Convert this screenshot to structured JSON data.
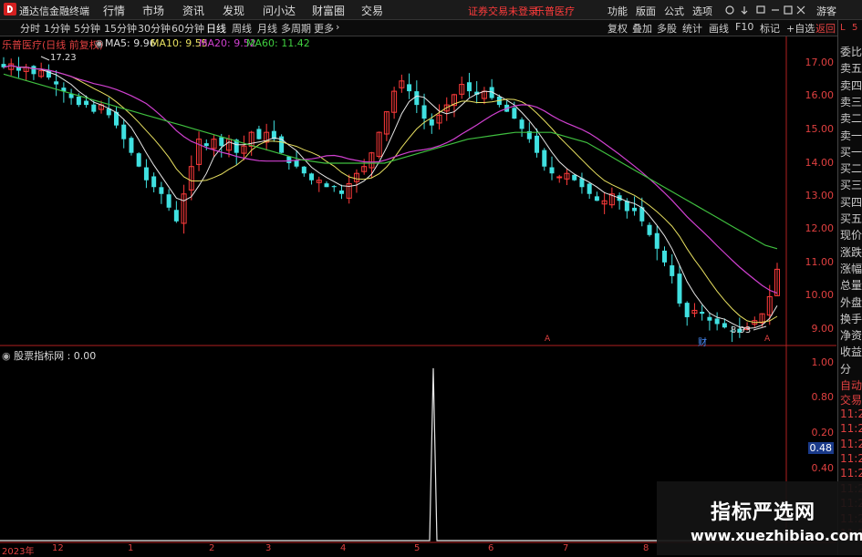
{
  "titlebar": {
    "app_title": "通达信金融终端",
    "menu": [
      "行情",
      "市场",
      "资讯",
      "发现",
      "问小达",
      "财富圈",
      "交易"
    ],
    "trade_warning": "证券交易未登录",
    "trade_stock": "乐普医疗",
    "right_menu": [
      "功能",
      "版面",
      "公式",
      "选项"
    ],
    "guest": "游客"
  },
  "toolbar": {
    "periods": [
      "分时",
      "1分钟",
      "5分钟",
      "15分钟",
      "30分钟",
      "60分钟",
      "日线",
      "周线",
      "月线",
      "多周期",
      "更多"
    ],
    "active_period": "日线",
    "buttons": [
      "复权",
      "叠加",
      "多股",
      "统计",
      "画线",
      "F10",
      "标记",
      "+自选",
      "返回"
    ]
  },
  "chart_info": {
    "stock_label": "乐普医疗(日线 前复权)",
    "ma5": "MA5: 9.96",
    "ma10": "MA10: 9.55",
    "ma20": "MA20: 9.52",
    "ma60": "MA60: 11.42"
  },
  "annotations": {
    "high_label": "17.23",
    "low_label": "8.93",
    "marker_cai": "财",
    "marker_a1": "A",
    "marker_a2": "A"
  },
  "indicator": {
    "label": "股票指标网 : 0.00",
    "current_badge": "0.48"
  },
  "price_axis": [
    "17.00",
    "16.00",
    "15.00",
    "14.00",
    "13.00",
    "12.00",
    "11.00",
    "10.00",
    "9.00"
  ],
  "indicator_axis": [
    "1.00",
    "0.80",
    "0.48",
    "0.40",
    "0.20"
  ],
  "date_axis": [
    "2023年",
    "12",
    "1",
    "2",
    "3",
    "4",
    "5",
    "6",
    "7",
    "8"
  ],
  "side_panel": {
    "top_letter": "L",
    "top_num": "5",
    "items": [
      "委比",
      "卖五",
      "卖四",
      "卖三",
      "卖二",
      "卖一",
      "买一",
      "买二",
      "买三",
      "买四",
      "买五",
      "现价",
      "涨跌",
      "涨幅",
      "总量",
      "外盘",
      "换手",
      "净资",
      "收益",
      "分",
      "自动",
      "交易",
      "11:2",
      "11:2",
      "11:2",
      "11:2",
      "11:2",
      "11:2",
      "11:2",
      "11:2",
      "11:2"
    ]
  },
  "watermark": {
    "title": "指标严选网",
    "url": "www.xuezhibiao.com"
  },
  "chart_data": {
    "type": "candlestick",
    "price_ylim": [
      8.6,
      17.6
    ],
    "main_close": [
      16.7,
      16.8,
      16.6,
      16.7,
      16.5,
      16.6,
      16.4,
      16.2,
      16.0,
      15.8,
      15.6,
      15.6,
      15.4,
      15.6,
      15.3,
      15.0,
      14.6,
      14.2,
      13.8,
      13.4,
      13.2,
      13.0,
      12.6,
      12.2,
      13.0,
      13.8,
      14.6,
      14.4,
      14.6,
      14.4,
      14.6,
      14.2,
      14.4,
      14.8,
      14.6,
      14.8,
      14.6,
      14.2,
      13.9,
      13.8,
      13.6,
      13.4,
      13.4,
      13.2,
      13.2,
      13.0,
      13.3,
      13.6,
      13.8,
      14.2,
      14.8,
      15.4,
      16.0,
      16.3,
      16.0,
      15.6,
      15.2,
      15.0,
      15.3,
      15.6,
      15.9,
      16.2,
      16.0,
      15.9,
      16.0,
      15.8,
      15.6,
      15.4,
      15.2,
      14.9,
      14.6,
      14.2,
      13.8,
      13.6,
      13.5,
      13.6,
      13.4,
      13.2,
      13.0,
      12.8,
      12.8,
      13.0,
      12.8,
      12.5,
      12.5,
      12.2,
      11.8,
      11.4,
      11.0,
      10.6,
      9.8,
      9.4,
      9.6,
      9.5,
      9.3,
      9.2,
      9.1,
      9.0,
      8.95,
      9.1,
      9.3,
      9.5,
      10.0,
      10.8
    ],
    "ma60": [
      16.5,
      16.4,
      16.3,
      16.2,
      16.1,
      16.0,
      15.9,
      15.8,
      15.7,
      15.6,
      15.5,
      15.4,
      15.3,
      15.2,
      15.1,
      15.0,
      14.9,
      14.8,
      14.7,
      14.6,
      14.5,
      14.4,
      14.3,
      14.2,
      14.1,
      14.0,
      13.95,
      13.9,
      13.9,
      13.9,
      13.9,
      13.9,
      13.9,
      14.0,
      14.1,
      14.2,
      14.3,
      14.4,
      14.5,
      14.6,
      14.65,
      14.7,
      14.75,
      14.8,
      14.8,
      14.8,
      14.8,
      14.7,
      14.6,
      14.5,
      14.3,
      14.1,
      13.9,
      13.7,
      13.5,
      13.3,
      13.1,
      12.9,
      12.7,
      12.5,
      12.3,
      12.1,
      11.9,
      11.7,
      11.5,
      11.4
    ],
    "indicator_ylim": [
      0,
      1.1
    ],
    "indicator_spike_index": 56,
    "indicator_spike_value": 1.0
  }
}
